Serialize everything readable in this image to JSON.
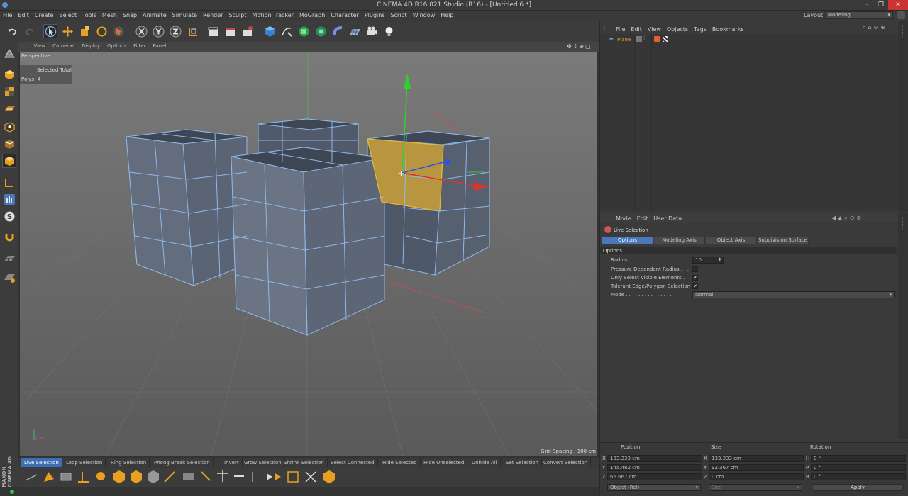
{
  "window": {
    "title": "CINEMA 4D R16.021 Studio (R16) - [Untitled 6 *]",
    "layout_label": "Layout:",
    "layout_value": "Modeling"
  },
  "menu": [
    "File",
    "Edit",
    "Create",
    "Select",
    "Tools",
    "Mesh",
    "Snap",
    "Animate",
    "Simulate",
    "Render",
    "Sculpt",
    "Motion Tracker",
    "MoGraph",
    "Character",
    "Plugins",
    "Script",
    "Window",
    "Help"
  ],
  "viewport": {
    "menu": [
      "View",
      "Cameras",
      "Display",
      "Options",
      "Filter",
      "Panel"
    ],
    "camera_label": "Perspective",
    "hud_header": "Selected Total",
    "hud_polys_label": "Polys",
    "hud_polys_value": "4",
    "grid_spacing": "Grid Spacing : 100 cm"
  },
  "selection_commands": [
    "Live Selection",
    "Loop Selection",
    "Ring Selection",
    "Phong Break Selection",
    "Invert",
    "Grow Selection",
    "Shrink Selection",
    "Select Connected",
    "Hide Selected",
    "Hide Unselected",
    "Unhide All",
    "Set Selection",
    "Convert Selection"
  ],
  "objects_panel": {
    "menu": [
      "File",
      "Edit",
      "View",
      "Objects",
      "Tags",
      "Bookmarks"
    ],
    "object_name": "Plane"
  },
  "attributes_panel": {
    "menu": [
      "Mode",
      "Edit",
      "User Data"
    ],
    "tool_name": "Live Selection",
    "tabs": [
      "Options",
      "Modeling Axis",
      "Object Axis",
      "Subdivision Surface"
    ],
    "section": "Options",
    "radius_label": "Radius . . . . . . . . . . . . . .",
    "radius_value": "10",
    "pressure_label": "Pressure Dependent Radius . . .",
    "visible_label": "Only Select Visible Elements . .",
    "tolerant_label": "Tolerant Edge/Polygon Selection",
    "mode_label": "Mode . . . . . . . . . . . . . . .",
    "mode_value": "Normal",
    "check_mark": "✔"
  },
  "coordinates": {
    "position_header": "Position",
    "size_header": "Size",
    "rotation_header": "Rotation",
    "x_label": "X",
    "y_label": "Y",
    "z_label": "Z",
    "h_label": "H",
    "p_label": "P",
    "b_label": "B",
    "pos_x": "133.333 cm",
    "pos_y": "145.482 cm",
    "pos_z": "66.667 cm",
    "size_x": "133.333 cm",
    "size_y": "92.367 cm",
    "size_z": "0 cm",
    "rot_h": "0 °",
    "rot_p": "0 °",
    "rot_b": "0 °",
    "mode_select": "Object (Rel)",
    "size_select": "Size",
    "apply_label": "Apply"
  },
  "brand": "MAXON CINEMA 4D",
  "colors": {
    "accent": "#4a78b8",
    "selection": "#e8b830",
    "wire": "#8fb8e8",
    "viewport": "#6d6d6d"
  }
}
